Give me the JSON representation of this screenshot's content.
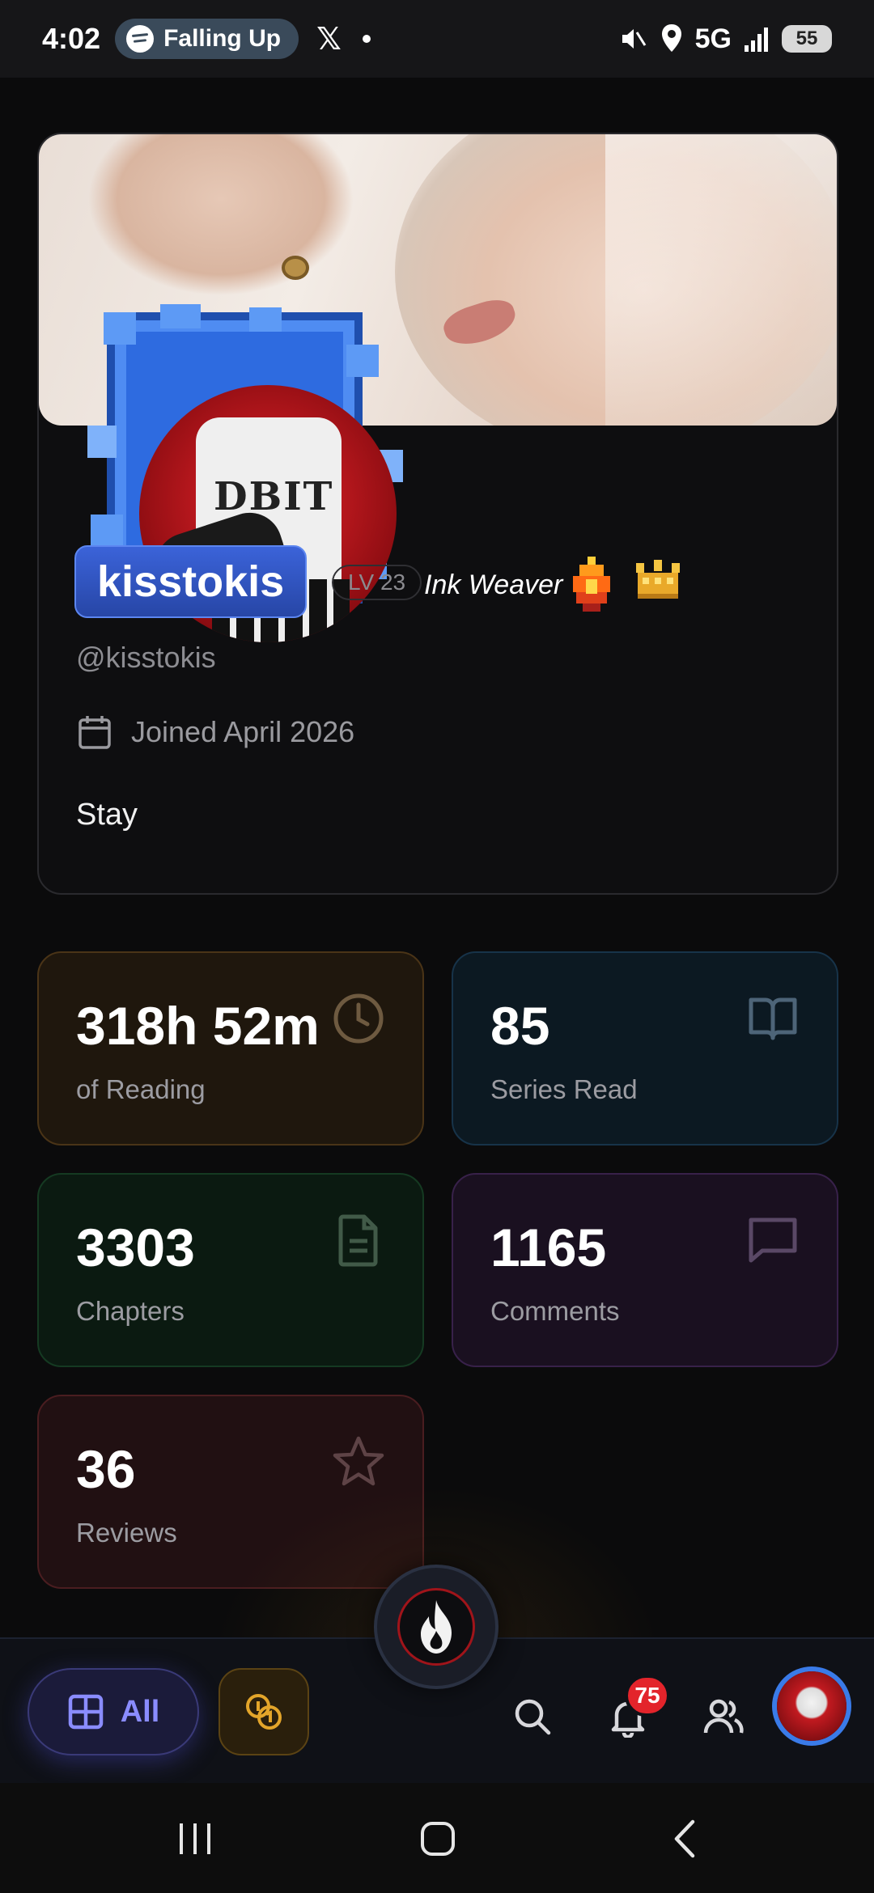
{
  "status_bar": {
    "time": "4:02",
    "media_pill": "Falling Up",
    "x_app": "𝕏",
    "network": "5G",
    "battery": "55"
  },
  "profile": {
    "display_name": "kisstokis",
    "level": "LV 23",
    "title": "Ink Weaver",
    "handle": "@kisstokis",
    "joined": "Joined April 2026",
    "bio": "Stay",
    "avatar_shirt_text": "DBIT"
  },
  "stats": [
    {
      "value": "318h 52m",
      "label": "of Reading",
      "icon": "clock-icon"
    },
    {
      "value": "85",
      "label": "Series Read",
      "icon": "book-icon"
    },
    {
      "value": "3303",
      "label": "Chapters",
      "icon": "document-icon"
    },
    {
      "value": "1165",
      "label": "Comments",
      "icon": "comment-icon"
    },
    {
      "value": "36",
      "label": "Reviews",
      "icon": "star-icon"
    }
  ],
  "bottom_nav": {
    "all_label": "All",
    "notifications_count": "75"
  },
  "colors": {
    "accent_blue": "#3b63d9",
    "all_button": "#8a8cff",
    "notification_badge": "#e3242b",
    "coin": "#e3a52a"
  }
}
